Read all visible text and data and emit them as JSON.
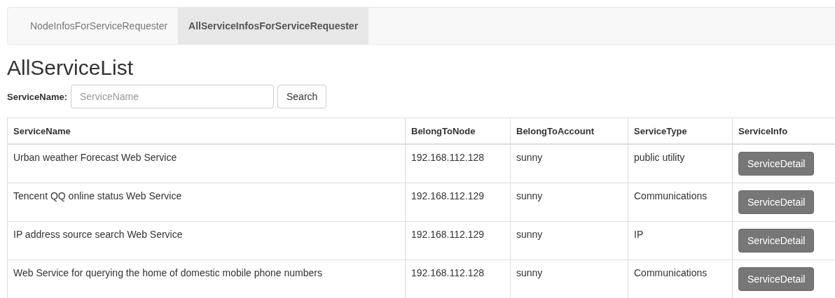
{
  "nav": {
    "tabs": [
      {
        "label": "NodeInfosForServiceRequester",
        "selected": false
      },
      {
        "label": "AllServiceInfosForServiceRequester",
        "selected": true
      }
    ]
  },
  "title": "AllServiceList",
  "search": {
    "label": "ServiceName:",
    "placeholder": "ServiceName",
    "button": "Search"
  },
  "table": {
    "columns": [
      "ServiceName",
      "BelongToNode",
      "BelongToAccount",
      "ServiceType",
      "ServiceInfo"
    ],
    "rows": [
      {
        "cells": [
          "Urban weather Forecast Web Service",
          "192.168.112.128",
          "sunny",
          "public utility"
        ],
        "button": "ServiceDetail"
      },
      {
        "cells": [
          "Tencent QQ online status Web Service",
          "192.168.112.129",
          "sunny",
          "Communications"
        ],
        "button": "ServiceDetail"
      },
      {
        "cells": [
          "IP address source search Web Service",
          "192.168.112.129",
          "sunny",
          "IP"
        ],
        "button": "ServiceDetail"
      },
      {
        "cells": [
          "Web Service for querying the home of domestic mobile phone numbers",
          "192.168.112.128",
          "sunny",
          "Communications"
        ],
        "button": "ServiceDetail"
      }
    ]
  }
}
